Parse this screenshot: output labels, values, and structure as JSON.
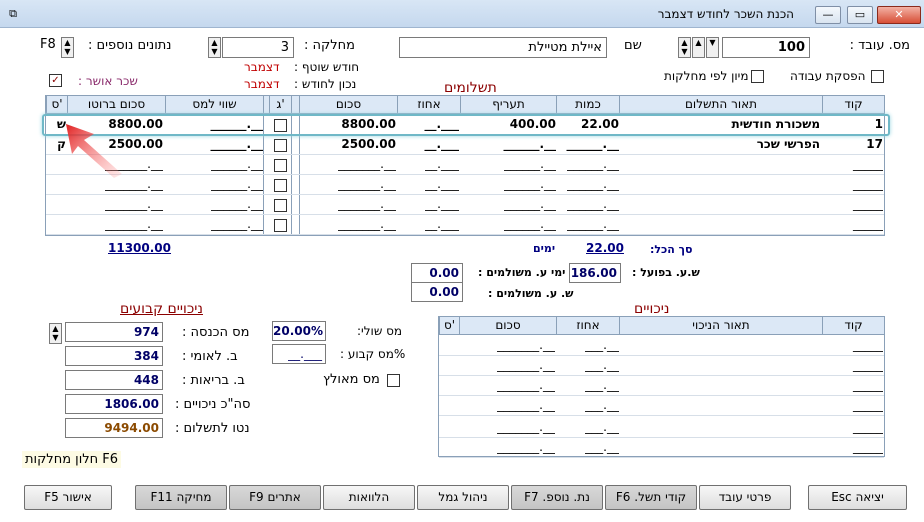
{
  "window": {
    "title": "הכנת השכר לחודש דצמבר",
    "sys_icon": "⧉",
    "min_label": "—",
    "max_label": "▭",
    "close_label": "✕"
  },
  "header": {
    "employee_label": "מס. עובד :",
    "employee_no": "100",
    "name_label": "שם",
    "employee_name": "איילת מטיילת",
    "dept_label": "מחלקה :",
    "dept_value": "3",
    "extra_label": "נתונים נוספים :",
    "extra_key": "F8",
    "stop_work_label": "הפסקת עבודה",
    "sort_dept_label": "מיון לפי מחלקות",
    "current_month_label": "חודש שוטף :",
    "current_month": "דצמבר",
    "correct_for_label": "נכון לחודש :",
    "correct_for": "דצמבר",
    "approved_label": "שכר אושר :",
    "approved_check": "✓"
  },
  "payments": {
    "title": "תשלומים",
    "columns": [
      "קוד",
      "תאור התשלום",
      "כמות",
      "תעריף",
      "אחוז",
      "סכום",
      "ג'",
      "שווי למס",
      "סכום ברוטו",
      "ס'"
    ],
    "rows": [
      {
        "code": "1",
        "desc": "משכורת חודשית",
        "qty": "22.00",
        "rate": "400.00",
        "pct": "__.___",
        "amount": "8800.00",
        "taxval": "______.__",
        "gross": "8800.00",
        "s": "ש"
      },
      {
        "code": "17",
        "desc": "הפרשי שכר",
        "qty": "______.__",
        "rate": "______.__",
        "pct": "__.___",
        "amount": "2500.00",
        "taxval": "______.__",
        "gross": "2500.00",
        "s": "ק"
      }
    ],
    "blank_dash_short": "______.__",
    "blank_dash_pct": "__.___",
    "blank_dash_amount": "_______.__",
    "total_gross": "11300.00",
    "total_label": "סך הכל:",
    "total_days": "22.00",
    "days_label": "ימים"
  },
  "hours": {
    "actual_label": "ש.ע. בפועל :",
    "actual_value": "186.00",
    "paid_days_label": "ימי ע. משולמים :",
    "paid_days_value": "0.00",
    "paid_hours_label": "ש. ע. משולמים :",
    "paid_hours_value": "0.00"
  },
  "deductions": {
    "title": "ניכויים",
    "columns": [
      "קוד",
      "תאור הניכוי",
      "אחוז",
      "סכום",
      "ס'"
    ],
    "blank_code": "_____",
    "blank_pct": "___.__",
    "blank_amount": "_______.__"
  },
  "fixed": {
    "title": "ניכויים קבועים",
    "income_tax_label": "מס הכנסה :",
    "income_tax": "974",
    "national_ins_label": "ב. לאומי :",
    "national_ins": "384",
    "health_label": "ב. בריאות :",
    "health": "448",
    "total_ded_label": "סה\"כ ניכויים :",
    "total_ded": "1806.00",
    "net_label": "נטו לתשלום :",
    "net": "9494.00",
    "marginal_label": "מס שולי:",
    "marginal": "20.00%",
    "fixed_tax_label": "%מס קבוע :",
    "fixed_tax": "__.___",
    "enforced_label": "מס מאולץ"
  },
  "f6_note": "F6 חלון מחלקות",
  "buttons": {
    "exit": "יציאה Esc",
    "employee": "פרטי עובד",
    "pay_codes": "קודי תשל. F6",
    "extra_data": "נת. נוספ. F7",
    "pension": "ניהול גמל",
    "loans": "הלוואות",
    "sites": "אתרים F9",
    "delete": "מחיקה F11",
    "approve": "אישור F5"
  }
}
